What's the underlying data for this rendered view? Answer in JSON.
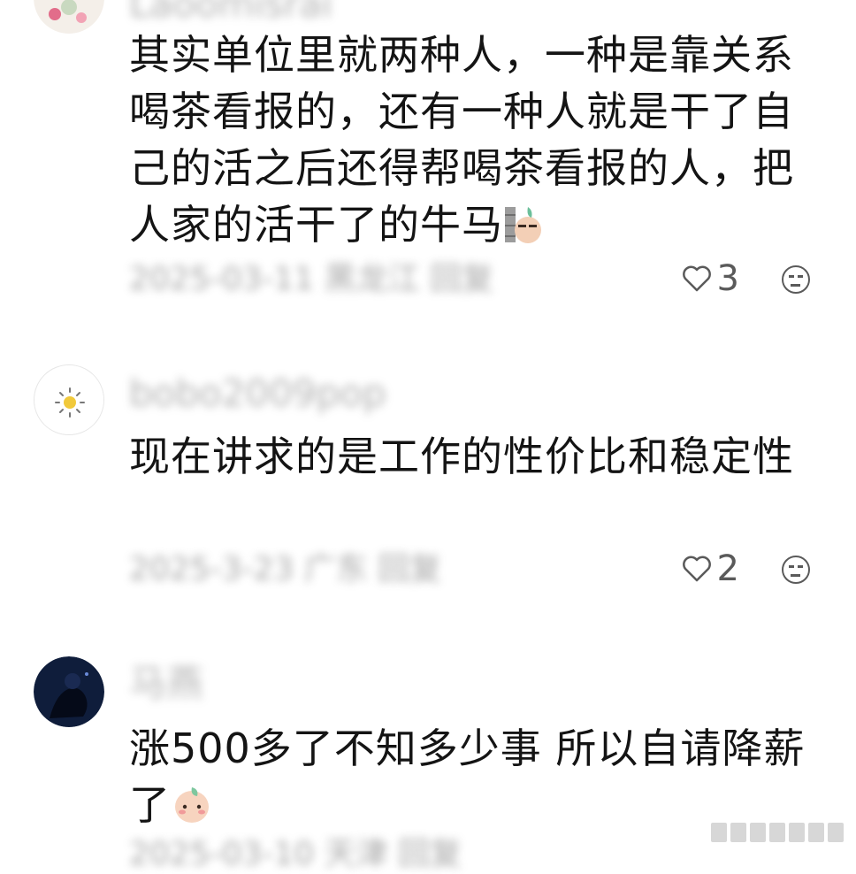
{
  "comments": [
    {
      "username": "Laoomisrai",
      "text_parts": [
        "其实单位里就两种人，一种是靠关系喝茶看报的，还有一种人就是干了自己的活之后还得帮喝茶看报的人，把人家的活干了的牛马"
      ],
      "sticker": "wall-peek-sticker",
      "meta": "2025-03-11 黑龙江 回复",
      "likes": "3",
      "like_icon": "heart-outline-icon",
      "react_icon": "neutral-face-icon"
    },
    {
      "username": "bobo2009pop",
      "text_parts": [
        "现在讲求的是工作的性价比和稳定性"
      ],
      "meta": "2025-3-23 广东 回复",
      "likes": "2",
      "like_icon": "heart-outline-icon",
      "react_icon": "neutral-face-icon"
    },
    {
      "username": "马燕",
      "text_parts": [
        "涨500多了不知多少事 所以自请降薪了"
      ],
      "sticker": "peach-blush-sticker",
      "meta": "2025-03-10 天津 回复"
    }
  ],
  "colors": {
    "text": "#141414",
    "muted": "#8a8a8a",
    "icon": "#5a5a5a",
    "background": "#ffffff"
  }
}
